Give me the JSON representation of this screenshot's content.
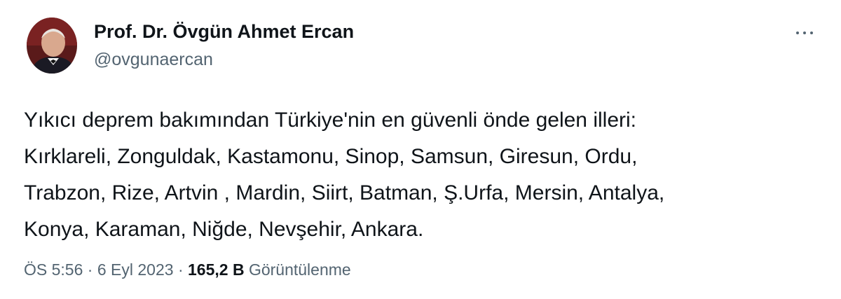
{
  "author": {
    "display_name": "Prof. Dr. Övgün Ahmet Ercan",
    "handle": "@ovgunaercan"
  },
  "more_icon": "more-horizontal-icon",
  "tweet": {
    "text_lines": [
      "Yıkıcı deprem bakımından Türkiye'nin en güvenli önde gelen illeri:",
      "Kırklareli, Zonguldak, Kastamonu, Sinop, Samsun, Giresun, Ordu,",
      "Trabzon, Rize, Artvin , Mardin, Siirt, Batman, Ş.Urfa, Mersin, Antalya,",
      "Konya, Karaman, Niğde, Nevşehir, Ankara."
    ]
  },
  "meta": {
    "time": "ÖS 5:56",
    "separator": "·",
    "date": "6 Eyl 2023",
    "views_count": "165,2 B",
    "views_label": "Görüntülenme"
  },
  "colors": {
    "text_primary": "#0f1419",
    "text_secondary": "#536471",
    "background": "#ffffff"
  }
}
